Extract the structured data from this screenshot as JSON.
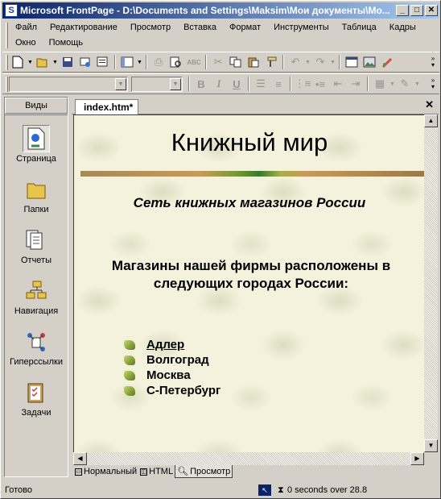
{
  "window": {
    "title": "Microsoft FrontPage - D:\\Documents and Settings\\Maksim\\Мои документы\\Мо...",
    "minimize": "_",
    "maximize": "□",
    "close": "✕"
  },
  "menu": {
    "items": [
      "Файл",
      "Редактирование",
      "Просмотр",
      "Вставка",
      "Формат",
      "Инструменты",
      "Таблица",
      "Кадры",
      "Окно",
      "Помощь"
    ]
  },
  "toolbar_standard": {
    "buttons": [
      "new-page-icon",
      "open-icon",
      "save-icon",
      "publish-icon",
      "folder-list-icon",
      "views-icon",
      "print-icon",
      "print-preview-icon",
      "spelling-icon",
      "cut-icon",
      "copy-icon",
      "paste-icon",
      "format-painter-icon",
      "undo-icon",
      "redo-icon",
      "web-component-icon",
      "insert-table-icon",
      "insert-picture-icon"
    ]
  },
  "toolbar_formatting": {
    "style_value": "",
    "font_value": "",
    "size_value": "",
    "bold": "B",
    "italic": "I",
    "underline": "U"
  },
  "views_bar": {
    "header": "Виды",
    "items": [
      {
        "label": "Страница",
        "icon": "page-view-icon",
        "active": true
      },
      {
        "label": "Папки",
        "icon": "folders-view-icon",
        "active": false
      },
      {
        "label": "Отчеты",
        "icon": "reports-view-icon",
        "active": false
      },
      {
        "label": "Навигация",
        "icon": "navigation-view-icon",
        "active": false
      },
      {
        "label": "Гиперссылки",
        "icon": "hyperlinks-view-icon",
        "active": false
      },
      {
        "label": "Задачи",
        "icon": "tasks-view-icon",
        "active": false
      }
    ]
  },
  "document": {
    "tab_label": "index.htm*",
    "close": "✕"
  },
  "page": {
    "heading": "Книжный мир",
    "subtitle": "Сеть книжных магазинов России",
    "paragraph_line1": "Магазины нашей фирмы расположены в",
    "paragraph_line2": "следующих городах России:",
    "cities": [
      {
        "name": "Адлер",
        "link": true
      },
      {
        "name": "Волгоград",
        "link": false
      },
      {
        "name": "Москва",
        "link": false
      },
      {
        "name": "С-Петербург",
        "link": false
      }
    ]
  },
  "view_tabs": [
    "Нормальный",
    "HTML",
    "Просмотр"
  ],
  "active_view_tab": "Просмотр",
  "status": {
    "text": "Готово",
    "download_time": "0 seconds over 28.8"
  }
}
